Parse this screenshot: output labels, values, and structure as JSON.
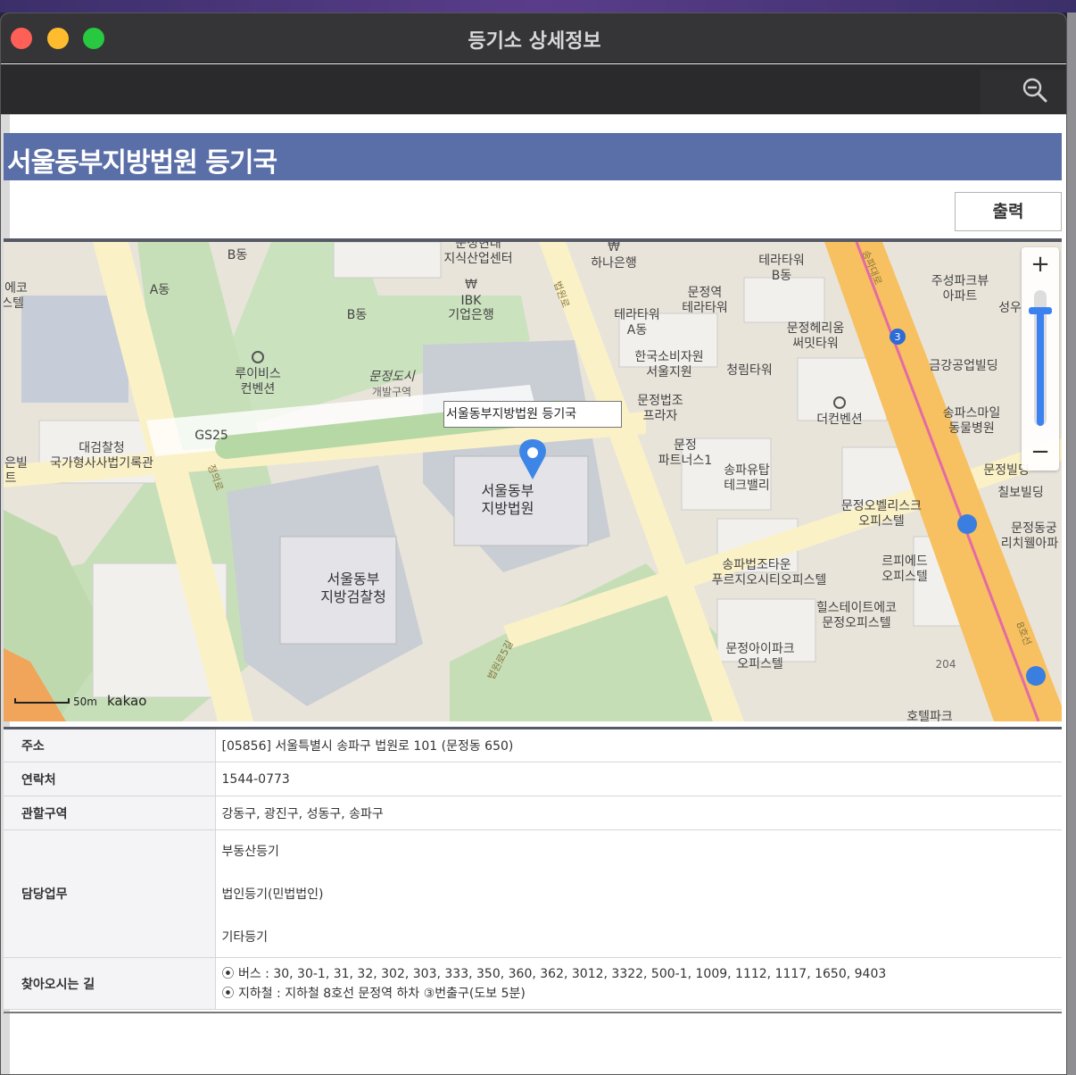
{
  "window": {
    "title": "등기소 상세정보"
  },
  "toolbar": {
    "zoom_icon": "magnifier-minus-icon"
  },
  "page": {
    "title": "서울동부지방법원 등기국",
    "print_label": "출력"
  },
  "map": {
    "marker_label": "서울동부지방법원 등기국",
    "scale_label": "50m",
    "brand": "kakao",
    "zoom_in": "+",
    "zoom_out": "−",
    "zoom_level": 0.85,
    "labels": {
      "b_dong_top": "B동",
      "a_dong": "A동",
      "b_dong_mid": "B동",
      "munjeong_hyundai_1": "문정현대",
      "munjeong_hyundai_2": "지식산업센터",
      "hana_bank": "하나은행",
      "ibk_1": "IBK",
      "ibk_2": "기업은행",
      "terra_b_1": "테라타워",
      "terra_b_2": "B동",
      "terra_a_1": "테라타워",
      "terra_a_2": "A동",
      "munjeong_terra_1": "문정역",
      "munjeong_terra_2": "테라타워",
      "jusung_1": "주성파크뷰",
      "jusung_2": "아파트",
      "seongwoo": "성우",
      "eco_1": "에코",
      "eco_2": "스텔",
      "luibis_1": "루이비스",
      "luibis_2": "컨벤션",
      "munjeongdosi_1": "문정도시",
      "munjeongdosi_2": "개발구역",
      "consumer_1": "한국소비자원",
      "consumer_2": "서울지원",
      "cheongrim": "청림타워",
      "herium_1": "문정헤리움",
      "herium_2": "써밋타워",
      "keumgang": "금강공업빌딩",
      "prosecution_records_1": "대검찰청",
      "prosecution_records_2": "국가형사사법기록관",
      "gs25": "GS25",
      "beopjo_plaza_1": "문정법조",
      "beopjo_plaza_2": "프라자",
      "theconvention": "더컨벤션",
      "songpa_vet_1": "송파스마일",
      "songpa_vet_2": "동물병원",
      "partners_1": "문정",
      "partners_2": "파트너스1",
      "tulip_1": "송파유탑",
      "tulip_2": "테크밸리",
      "court_1": "서울동부",
      "court_2": "지방법원",
      "munjeong_bldg": "문정빌딩",
      "chilbo": "칠보빌딩",
      "obelisk_1": "문정오벨리스크",
      "obelisk_2": "오피스텔",
      "richwell_1": "문정동궁",
      "richwell_2": "리치웰아파",
      "prosecutors_1": "서울동부",
      "prosecutors_2": "지방검찰청",
      "beopjotown_1": "송파법조타운",
      "beopjotown_2": "푸르지오시티오피스텔",
      "ripied_1": "르피에드",
      "ripied_2": "오피스텔",
      "hillstate_1": "힐스테이트에코",
      "hillstate_2": "문정오피스텔",
      "ipark_1": "문정아이파크",
      "ipark_2": "오피스텔",
      "hotel": "호텔파크",
      "road_204": "204",
      "road_jeongui": "정의로",
      "road_beopwon": "법원로",
      "road_beopwon5": "법원로5길",
      "road_songpa": "송파대로",
      "line8": "8호선",
      "route3": "3",
      "eunbil_1": "은빌",
      "eunbil_2": "트"
    }
  },
  "info": {
    "address": {
      "label": "주소",
      "value": "[05856] 서울특별시 송파구 법원로 101 (문정동 650)"
    },
    "contact": {
      "label": "연락처",
      "value": "1544-0773"
    },
    "jurisdiction": {
      "label": "관할구역",
      "value": "강동구, 광진구, 성동구, 송파구"
    },
    "duties": {
      "label": "담당업무",
      "items": [
        "부동산등기",
        "법인등기(민법법인)",
        "기타등기"
      ]
    },
    "directions": {
      "label": "찾아오시는 길",
      "bus": "⦿ 버스 : 30, 30-1, 31, 32, 302, 303, 333, 350, 360, 362, 3012, 3322, 500-1, 1009, 1112, 1117, 1650, 9403",
      "subway": "⦿ 지하철 : 지하철 8호선 문정역 하차 ③번출구(도보 5분)"
    }
  }
}
